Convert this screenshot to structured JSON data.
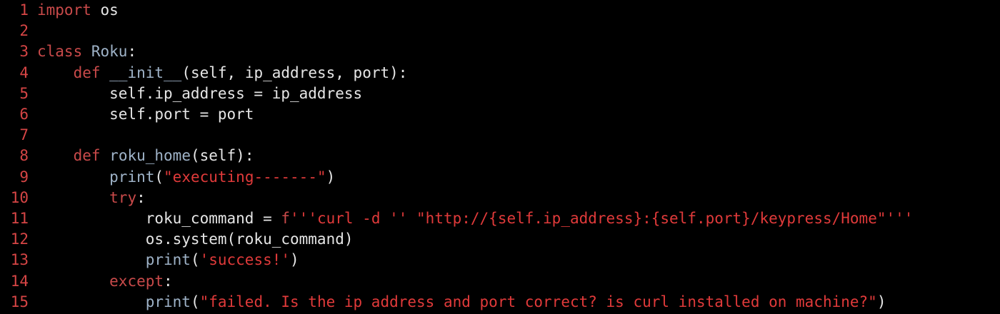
{
  "colors": {
    "background": "#000000",
    "line_number": "#d64545",
    "keyword": "#c94a4a",
    "plain": "#e6e6e6",
    "function": "#9fb3c8",
    "string": "#e03a3a"
  },
  "lines": [
    {
      "number": "1",
      "tokens": [
        {
          "type": "kw",
          "text": "import"
        },
        {
          "type": "plain",
          "text": " os"
        }
      ]
    },
    {
      "number": "2",
      "tokens": []
    },
    {
      "number": "3",
      "tokens": [
        {
          "type": "kw",
          "text": "class"
        },
        {
          "type": "plain",
          "text": " "
        },
        {
          "type": "fn",
          "text": "Roku"
        },
        {
          "type": "plain",
          "text": ":"
        }
      ]
    },
    {
      "number": "4",
      "tokens": [
        {
          "type": "plain",
          "text": "    "
        },
        {
          "type": "kw",
          "text": "def"
        },
        {
          "type": "plain",
          "text": " "
        },
        {
          "type": "fn",
          "text": "__init__"
        },
        {
          "type": "plain",
          "text": "(self, ip_address, port):"
        }
      ]
    },
    {
      "number": "5",
      "tokens": [
        {
          "type": "plain",
          "text": "        self.ip_address = ip_address"
        }
      ]
    },
    {
      "number": "6",
      "tokens": [
        {
          "type": "plain",
          "text": "        self.port = port"
        }
      ]
    },
    {
      "number": "7",
      "tokens": []
    },
    {
      "number": "8",
      "tokens": [
        {
          "type": "plain",
          "text": "    "
        },
        {
          "type": "kw",
          "text": "def"
        },
        {
          "type": "plain",
          "text": " "
        },
        {
          "type": "fn",
          "text": "roku_home"
        },
        {
          "type": "plain",
          "text": "(self):"
        }
      ]
    },
    {
      "number": "9",
      "tokens": [
        {
          "type": "plain",
          "text": "        "
        },
        {
          "type": "fn",
          "text": "print"
        },
        {
          "type": "plain",
          "text": "("
        },
        {
          "type": "str",
          "text": "\"executing-------\""
        },
        {
          "type": "plain",
          "text": ")"
        }
      ]
    },
    {
      "number": "10",
      "tokens": [
        {
          "type": "plain",
          "text": "        "
        },
        {
          "type": "kw",
          "text": "try"
        },
        {
          "type": "plain",
          "text": ":"
        }
      ]
    },
    {
      "number": "11",
      "tokens": [
        {
          "type": "plain",
          "text": "            roku_command = "
        },
        {
          "type": "kw",
          "text": "f"
        },
        {
          "type": "str",
          "text": "'''curl -d '' \"http://{self.ip_address}:{self.port}/keypress/Home\"'''"
        }
      ]
    },
    {
      "number": "12",
      "tokens": [
        {
          "type": "plain",
          "text": "            os.system(roku_command)"
        }
      ]
    },
    {
      "number": "13",
      "tokens": [
        {
          "type": "plain",
          "text": "            "
        },
        {
          "type": "fn",
          "text": "print"
        },
        {
          "type": "plain",
          "text": "("
        },
        {
          "type": "str",
          "text": "'success!'"
        },
        {
          "type": "plain",
          "text": ")"
        }
      ]
    },
    {
      "number": "14",
      "tokens": [
        {
          "type": "plain",
          "text": "        "
        },
        {
          "type": "kw",
          "text": "except"
        },
        {
          "type": "plain",
          "text": ":"
        }
      ]
    },
    {
      "number": "15",
      "tokens": [
        {
          "type": "plain",
          "text": "            "
        },
        {
          "type": "fn",
          "text": "print"
        },
        {
          "type": "plain",
          "text": "("
        },
        {
          "type": "str",
          "text": "\"failed. Is the ip address and port correct? is curl installed on machine?\""
        },
        {
          "type": "plain",
          "text": ")"
        }
      ]
    }
  ]
}
